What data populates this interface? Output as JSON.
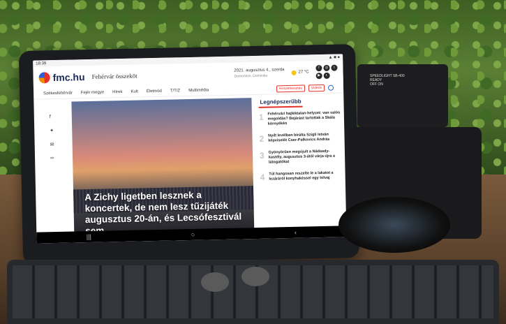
{
  "status": {
    "time": "18:39",
    "icons": "▲ ■ ●"
  },
  "site": {
    "logo": "fmc.hu",
    "region": "Fehérvár összeköt",
    "date": "2021. augusztus 4., szerda",
    "nameday": "Domonkos, Dominika",
    "temperature": "27 °C"
  },
  "nav": {
    "items": [
      "Székesfehérvár",
      "Fejér megye",
      "Hírek",
      "Kult",
      "Életmód",
      "T/T/Z",
      "Multimédia"
    ],
    "btn1": "Hírszerkesztés",
    "btn2": "Videók"
  },
  "hero": {
    "headline": "A Zichy ligetben lesznek a koncertek, de nem lesz tűzijáték augusztus 20-án, és Lecsófesztivál sem"
  },
  "sidebar": {
    "title": "Legnépszerűbb",
    "items": [
      {
        "num": "1",
        "text": "Fehérvári hajléktalan-helyzet: van valós megoldás? Bejárást tartottak a Skála környékén"
      },
      {
        "num": "2",
        "text": "Nyílt levélben bírálta Szigli István képviselőt Cser-Palkovics András"
      },
      {
        "num": "3",
        "text": "Gyönyörűen megújult a Nádasdy-kastély, augusztus 3-ától várja újra a látogatókat"
      },
      {
        "num": "4",
        "text": "Túl hangosan reszelte le a lakatot a lezáráról konyhakéssel egy tolvaj"
      }
    ]
  },
  "flash": {
    "brand": "SPEEDLIGHT SB-400",
    "ready": "READY",
    "offon": "OFF ON"
  },
  "icons": [
    "facebook-icon",
    "twitter-icon",
    "mail-icon",
    "link-icon",
    "instagram-icon",
    "youtube-icon",
    "search-icon",
    "sun-icon"
  ]
}
